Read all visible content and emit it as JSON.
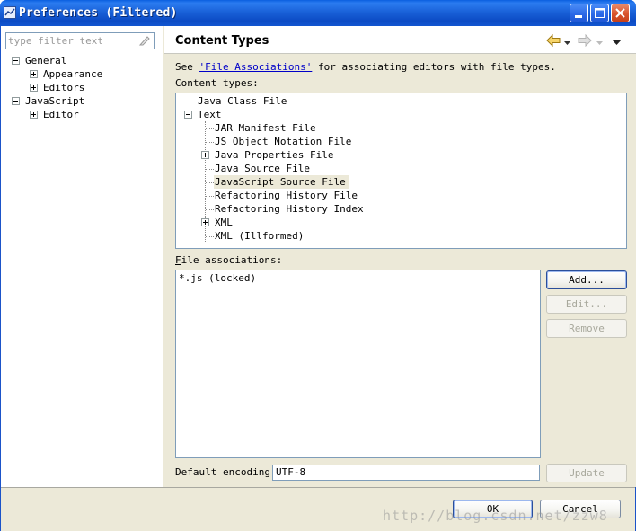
{
  "window": {
    "title": "Preferences (Filtered)",
    "icon": "preferences-app-icon",
    "controls": [
      "minimize-icon",
      "maximize-icon",
      "close-icon"
    ]
  },
  "sidebar": {
    "filter_placeholder": "type filter text",
    "filter_value": "",
    "tree": {
      "general": "General",
      "appearance": "Appearance",
      "editors": "Editors",
      "javascript": "JavaScript",
      "editor": "Editor"
    }
  },
  "page": {
    "title": "Content Types",
    "nav_icons": [
      "back-arrow-icon",
      "back-dropdown-icon",
      "forward-arrow-icon",
      "forward-dropdown-icon",
      "view-menu-icon"
    ],
    "description_prefix": "See ",
    "description_link": "'File Associations'",
    "description_suffix": " for associating editors with file types.",
    "content_types_label": "Content types:",
    "content_types": {
      "java_class_file": "Java Class File",
      "text": "Text",
      "jar_manifest": "JAR Manifest File",
      "json": "JS Object Notation File",
      "java_properties": "Java Properties File",
      "java_source": "Java Source File",
      "javascript_source": "JavaScript Source File",
      "refactoring_history_file": "Refactoring History File",
      "refactoring_history_index": "Refactoring History Index",
      "xml": "XML",
      "xml_illformed": "XML (Illformed)"
    },
    "selected_content_type": "JavaScript Source File",
    "file_associations_label": "File associations:",
    "file_associations": [
      "*.js (locked)"
    ],
    "buttons": {
      "add": "Add...",
      "edit": "Edit...",
      "remove": "Remove",
      "update": "Update"
    },
    "default_encoding_label": "Default encoding:",
    "default_encoding_value": "UTF-8"
  },
  "footer": {
    "ok": "OK",
    "cancel": "Cancel",
    "watermark": "http://blog.csdn.net/zzw8"
  },
  "colors": {
    "titlebar": "#0c4bc4",
    "dialog_bg": "#ece9d8",
    "link": "#0000c8",
    "selection": "#ece9d8",
    "input_border": "#7f9db9"
  }
}
